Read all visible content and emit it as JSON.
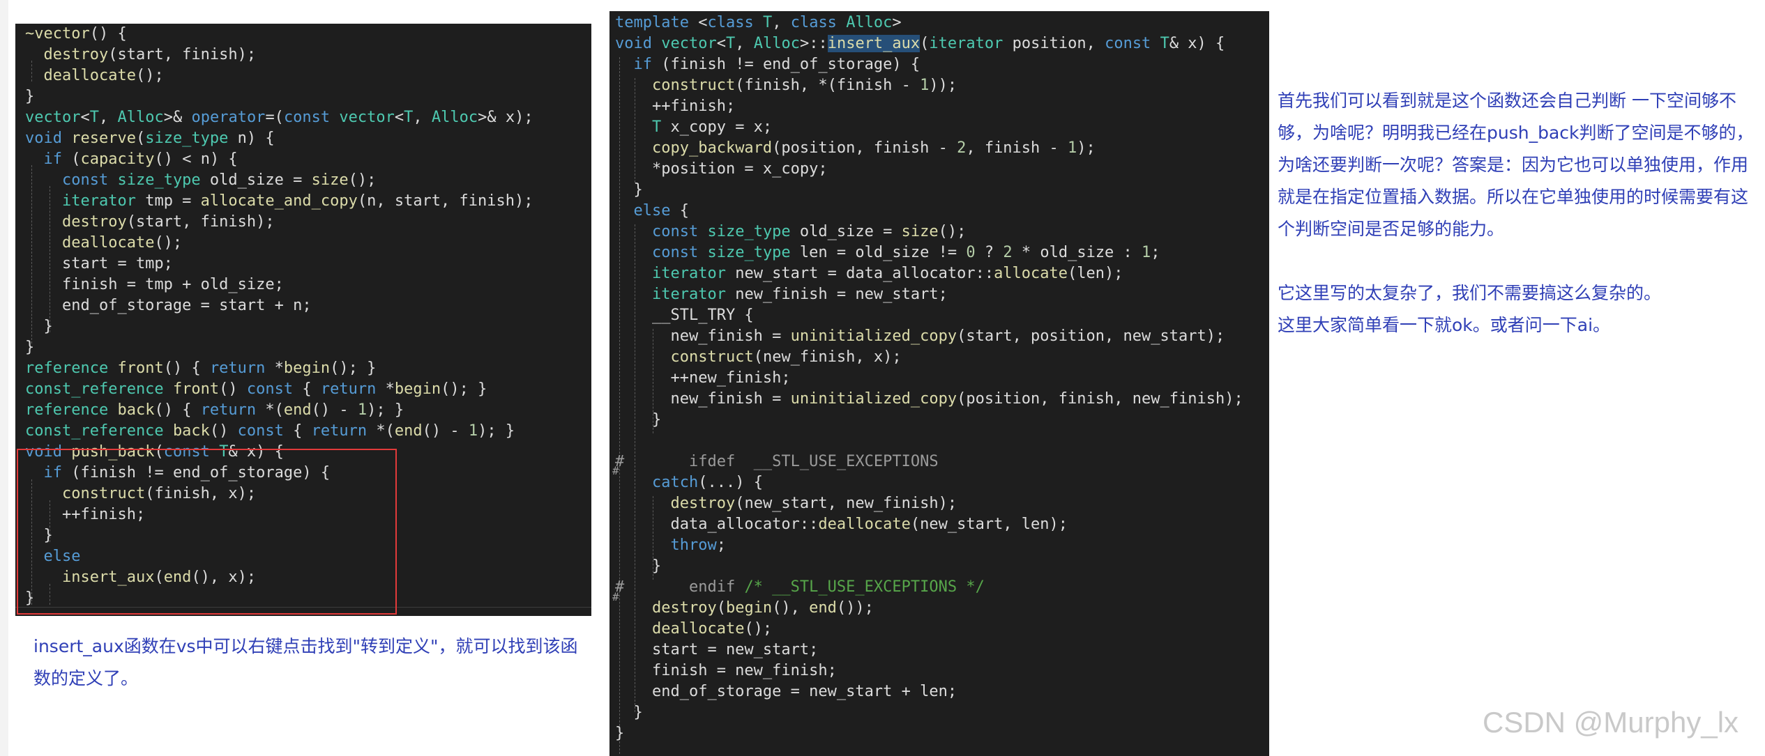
{
  "left_code": {
    "lines": [
      "~vector() {",
      "  destroy(start, finish);",
      "  deallocate();",
      "}",
      "vector<T, Alloc>& operator=(const vector<T, Alloc>& x);",
      "void reserve(size_type n) {",
      "  if (capacity() < n) {",
      "    const size_type old_size = size();",
      "    iterator tmp = allocate_and_copy(n, start, finish);",
      "    destroy(start, finish);",
      "    deallocate();",
      "    start = tmp;",
      "    finish = tmp + old_size;",
      "    end_of_storage = start + n;",
      "  }",
      "}",
      "reference front() { return *begin(); }",
      "const_reference front() const { return *begin(); }",
      "reference back() { return *(end() - 1); }",
      "const_reference back() const { return *(end() - 1); }",
      "void push_back(const T& x) {",
      "  if (finish != end_of_storage) {",
      "    construct(finish, x);",
      "    ++finish;",
      "  }",
      "  else",
      "    insert_aux(end(), x);",
      "}"
    ]
  },
  "right_code": {
    "lines": [
      "template <class T, class Alloc>",
      "void vector<T, Alloc>::insert_aux(iterator position, const T& x) {",
      "  if (finish != end_of_storage) {",
      "    construct(finish, *(finish - 1));",
      "    ++finish;",
      "    T x_copy = x;",
      "    copy_backward(position, finish - 2, finish - 1);",
      "    *position = x_copy;",
      "  }",
      "  else {",
      "    const size_type old_size = size();",
      "    const size_type len = old_size != 0 ? 2 * old_size : 1;",
      "    iterator new_start = data_allocator::allocate(len);",
      "    iterator new_finish = new_start;",
      "    __STL_TRY {",
      "      new_finish = uninitialized_copy(start, position, new_start);",
      "      construct(new_finish, x);",
      "      ++new_finish;",
      "      new_finish = uninitialized_copy(position, finish, new_finish);",
      "    }",
      "",
      "#       ifdef  __STL_USE_EXCEPTIONS",
      "    catch(...) {",
      "      destroy(new_start, new_finish);",
      "      data_allocator::deallocate(new_start, len);",
      "      throw;",
      "    }",
      "#       endif /* __STL_USE_EXCEPTIONS */",
      "    destroy(begin(), end());",
      "    deallocate();",
      "    start = new_start;",
      "    finish = new_finish;",
      "    end_of_storage = new_start + len;",
      "  }",
      "}"
    ]
  },
  "notes": {
    "bottom": "insert_aux函数在vs中可以右键点击找到\"转到定义\"，就可以找到该函数的定义了。",
    "right_paragraph_1": "首先我们可以看到就是这个函数还会自己判断  一下空间够不够，为啥呢？明明我已经在push_back判断了空间是不够的，为啥还要判断一次呢？答案是：因为它也可以单独使用，作用就是在指定位置插入数据。所以在它单独使用的时候需要有这个判断空间是否足够的能力。",
    "right_paragraph_2": "它这里写的太复杂了，我们不需要搞这么复杂的。",
    "right_paragraph_3": " 这里大家简单看一下就ok。或者问一下ai。"
  },
  "watermark": "CSDN @Murphy_lx",
  "colors": {
    "editor_bg": "#1e1e1e",
    "keyword": "#569cd6",
    "function": "#dcdcaa",
    "type": "#4ec9b0",
    "comment": "#57a64a",
    "highlight_box": "#e23a3a",
    "note_text": "#2f3fb6"
  }
}
